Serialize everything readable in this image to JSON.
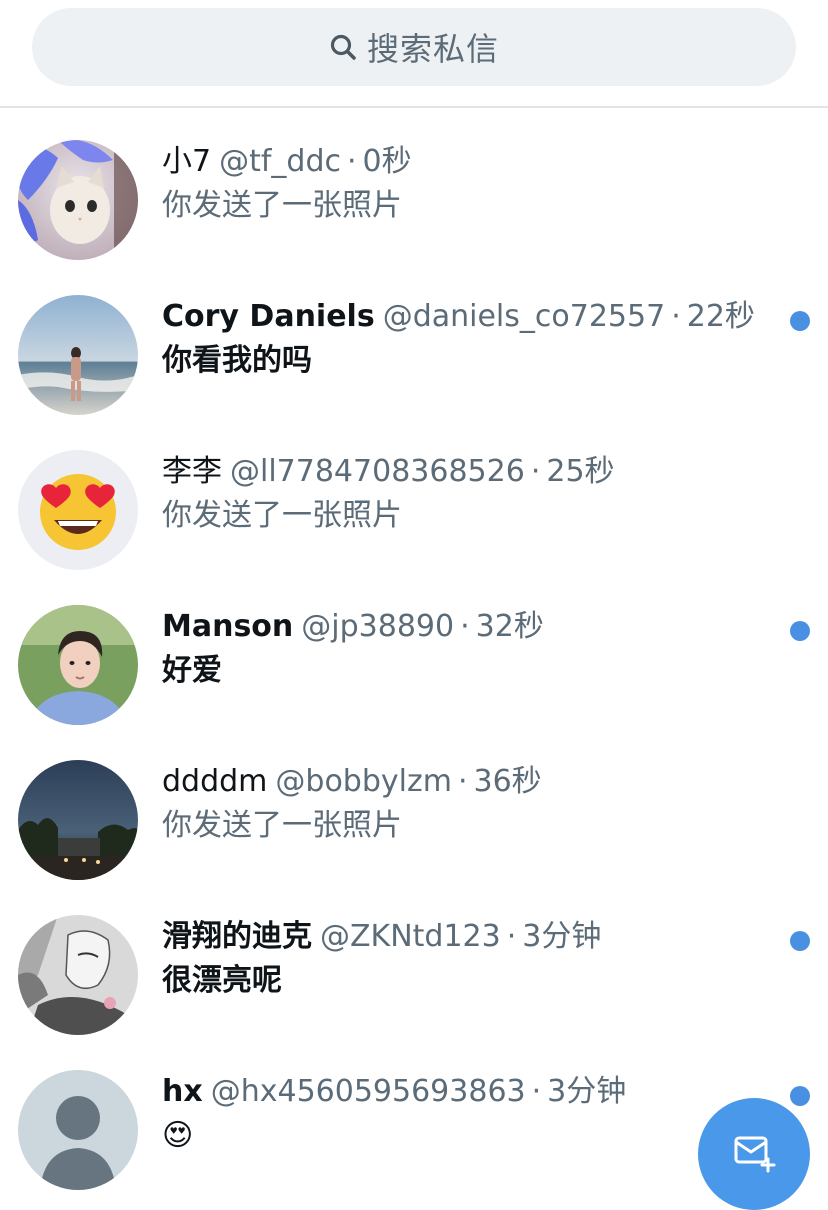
{
  "search": {
    "placeholder": "搜索私信",
    "icon": "search-icon"
  },
  "accent_color": "#4a90e2",
  "separator": "·",
  "conversations": [
    {
      "name": "小7",
      "handle": "@tf_ddc",
      "time": "0秒",
      "preview": "你发送了一张照片",
      "unread": false,
      "avatar": "cat-avatar"
    },
    {
      "name": "Cory Daniels",
      "handle": "@daniels_co72557",
      "time": "22秒",
      "preview": "你看我的吗",
      "unread": true,
      "avatar": "beach-avatar"
    },
    {
      "name": "李李",
      "handle": "@ll7784708368526",
      "time": "25秒",
      "preview": "你发送了一张照片",
      "unread": false,
      "avatar": "heart-eyes-emoji-avatar"
    },
    {
      "name": "Manson",
      "handle": "@jp38890",
      "time": "32秒",
      "preview": "好爱",
      "unread": true,
      "avatar": "portrait-avatar"
    },
    {
      "name": "ddddm",
      "handle": "@bobbylzm",
      "time": "36秒",
      "preview": "你发送了一张照片",
      "unread": false,
      "avatar": "night-scene-avatar"
    },
    {
      "name": "滑翔的迪克",
      "handle": "@ZKNtd123",
      "time": "3分钟",
      "preview": "很漂亮呢",
      "unread": true,
      "avatar": "manga-avatar"
    },
    {
      "name": "hx",
      "handle": "@hx4560595693863",
      "time": "3分钟",
      "preview": "😍",
      "unread": true,
      "avatar": "default-user-avatar"
    }
  ],
  "fab": {
    "icon": "new-message-icon"
  }
}
